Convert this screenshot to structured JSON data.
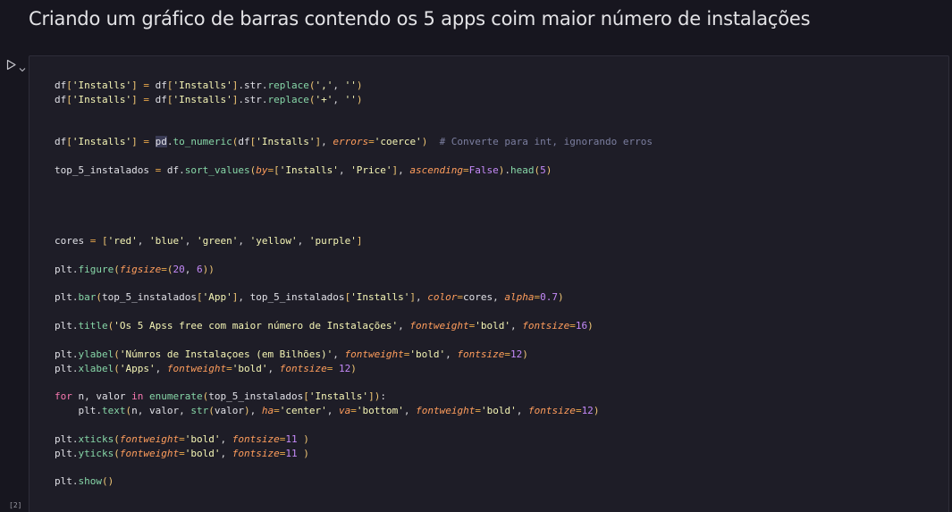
{
  "markdown": {
    "heading": "Criando um gráfico de barras contendo os 5 apps coim maior número de instalações"
  },
  "cell": {
    "execution_count": "[2]",
    "run_icon": "play-icon",
    "collapse_icon": "chevron-down-icon",
    "code_lines": [
      "df['Installs'] = df['Installs'].str.replace(',', '')",
      "df['Installs'] = df['Installs'].str.replace('+', '')",
      "",
      "",
      "df['Installs'] = pd.to_numeric(df['Installs'], errors='coerce')  # Converte para int, ignorando erros",
      "",
      "top_5_instalados = df.sort_values(by=['Installs', 'Price'], ascending=False).head(5)",
      "",
      "",
      "",
      "",
      "cores = ['red', 'blue', 'green', 'yellow', 'purple']",
      "",
      "plt.figure(figsize=(20, 6))",
      "",
      "plt.bar(top_5_instalados['App'], top_5_instalados['Installs'], color=cores, alpha=0.7)",
      "",
      "plt.title('Os 5 Apss free com maior número de Instalações', fontweight='bold', fontsize=16)",
      "",
      "plt.ylabel('Númros de Instalaçoes (em Bilhões)', fontweight='bold', fontsize=12)",
      "plt.xlabel('Apps', fontweight='bold', fontsize= 12)",
      "",
      "for n, valor in enumerate(top_5_instalados['Installs']):",
      "    plt.text(n, valor, str(valor), ha='center', va='bottom', fontweight='bold', fontsize=12)",
      "",
      "plt.xticks(fontweight='bold', fontsize=11 )",
      "plt.yticks(fontweight='bold', fontsize=11 )",
      "",
      "plt.show()"
    ]
  }
}
